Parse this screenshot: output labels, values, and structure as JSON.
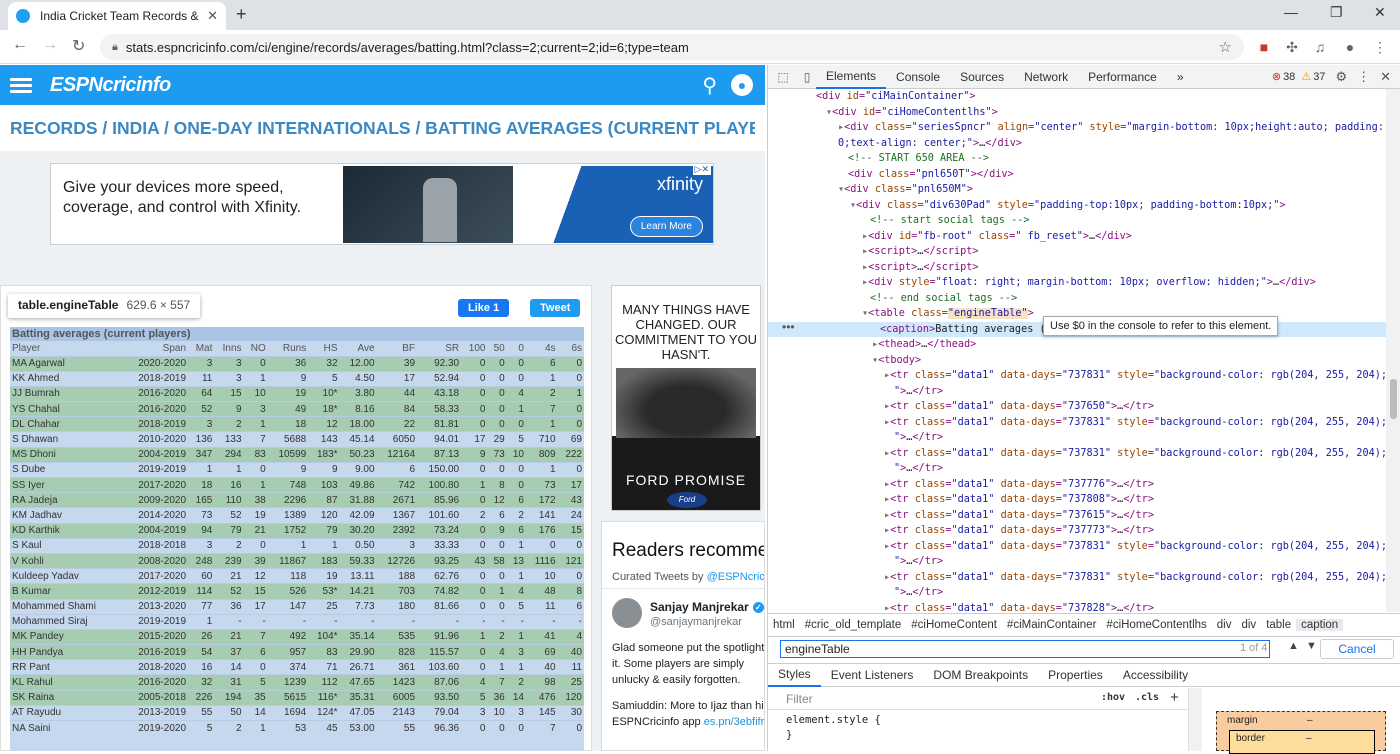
{
  "browser": {
    "tab_title": "India Cricket Team Records & Sta",
    "url": "stats.espncricinfo.com/ci/engine/records/averages/batting.html?class=2;current=2;id=6;type=team"
  },
  "site": {
    "logo": "ESPNcricinfo",
    "page_title": "RECORDS / INDIA / ONE-DAY INTERNATIONALS / BATTING AVERAGES (CURRENT PLAYERS)"
  },
  "ad1": {
    "text": "Give your devices more speed, coverage, and control with Xfinity.",
    "brand": "xfinity",
    "cta": "Learn More"
  },
  "ad2": {
    "text": "MANY THINGS HAVE CHANGED. OUR COMMITMENT TO YOU HASN'T.",
    "tagline": "FORD PROMISE",
    "brand": "Ford"
  },
  "inspector_tip": {
    "selector": "table.engineTable",
    "size": "629.6 × 557"
  },
  "social": {
    "like": "Like 1",
    "tweet": "Tweet"
  },
  "table": {
    "caption": "Batting averages (current players)",
    "headers": [
      "Player",
      "Span",
      "Mat",
      "Inns",
      "NO",
      "Runs",
      "HS",
      "Ave",
      "BF",
      "SR",
      "100",
      "50",
      "0",
      "4s",
      "6s"
    ],
    "rows": [
      [
        "MA Agarwal",
        "2020-2020",
        "3",
        "3",
        "0",
        "36",
        "32",
        "12.00",
        "39",
        "92.30",
        "0",
        "0",
        "0",
        "6",
        "0"
      ],
      [
        "KK Ahmed",
        "2018-2019",
        "11",
        "3",
        "1",
        "9",
        "5",
        "4.50",
        "17",
        "52.94",
        "0",
        "0",
        "0",
        "1",
        "0"
      ],
      [
        "JJ Bumrah",
        "2016-2020",
        "64",
        "15",
        "10",
        "19",
        "10*",
        "3.80",
        "44",
        "43.18",
        "0",
        "0",
        "4",
        "2",
        "1"
      ],
      [
        "YS Chahal",
        "2016-2020",
        "52",
        "9",
        "3",
        "49",
        "18*",
        "8.16",
        "84",
        "58.33",
        "0",
        "0",
        "1",
        "7",
        "0"
      ],
      [
        "DL Chahar",
        "2018-2019",
        "3",
        "2",
        "1",
        "18",
        "12",
        "18.00",
        "22",
        "81.81",
        "0",
        "0",
        "0",
        "1",
        "0"
      ],
      [
        "S Dhawan",
        "2010-2020",
        "136",
        "133",
        "7",
        "5688",
        "143",
        "45.14",
        "6050",
        "94.01",
        "17",
        "29",
        "5",
        "710",
        "69"
      ],
      [
        "MS Dhoni",
        "2004-2019",
        "347",
        "294",
        "83",
        "10599",
        "183*",
        "50.23",
        "12164",
        "87.13",
        "9",
        "73",
        "10",
        "809",
        "222"
      ],
      [
        "S Dube",
        "2019-2019",
        "1",
        "1",
        "0",
        "9",
        "9",
        "9.00",
        "6",
        "150.00",
        "0",
        "0",
        "0",
        "1",
        "0"
      ],
      [
        "SS Iyer",
        "2017-2020",
        "18",
        "16",
        "1",
        "748",
        "103",
        "49.86",
        "742",
        "100.80",
        "1",
        "8",
        "0",
        "73",
        "17"
      ],
      [
        "RA Jadeja",
        "2009-2020",
        "165",
        "110",
        "38",
        "2296",
        "87",
        "31.88",
        "2671",
        "85.96",
        "0",
        "12",
        "6",
        "172",
        "43"
      ],
      [
        "KM Jadhav",
        "2014-2020",
        "73",
        "52",
        "19",
        "1389",
        "120",
        "42.09",
        "1367",
        "101.60",
        "2",
        "6",
        "2",
        "141",
        "24"
      ],
      [
        "KD Karthik",
        "2004-2019",
        "94",
        "79",
        "21",
        "1752",
        "79",
        "30.20",
        "2392",
        "73.24",
        "0",
        "9",
        "6",
        "176",
        "15"
      ],
      [
        "S Kaul",
        "2018-2018",
        "3",
        "2",
        "0",
        "1",
        "1",
        "0.50",
        "3",
        "33.33",
        "0",
        "0",
        "1",
        "0",
        "0"
      ],
      [
        "V Kohli",
        "2008-2020",
        "248",
        "239",
        "39",
        "11867",
        "183",
        "59.33",
        "12726",
        "93.25",
        "43",
        "58",
        "13",
        "1116",
        "121"
      ],
      [
        "Kuldeep Yadav",
        "2017-2020",
        "60",
        "21",
        "12",
        "118",
        "19",
        "13.11",
        "188",
        "62.76",
        "0",
        "0",
        "1",
        "10",
        "0"
      ],
      [
        "B Kumar",
        "2012-2019",
        "114",
        "52",
        "15",
        "526",
        "53*",
        "14.21",
        "703",
        "74.82",
        "0",
        "1",
        "4",
        "48",
        "8"
      ],
      [
        "Mohammed Shami",
        "2013-2020",
        "77",
        "36",
        "17",
        "147",
        "25",
        "7.73",
        "180",
        "81.66",
        "0",
        "0",
        "5",
        "11",
        "6"
      ],
      [
        "Mohammed Siraj",
        "2019-2019",
        "1",
        "-",
        "-",
        "-",
        "-",
        "-",
        "-",
        "-",
        "-",
        "-",
        "-",
        "-",
        "-"
      ],
      [
        "MK Pandey",
        "2015-2020",
        "26",
        "21",
        "7",
        "492",
        "104*",
        "35.14",
        "535",
        "91.96",
        "1",
        "2",
        "1",
        "41",
        "4"
      ],
      [
        "HH Pandya",
        "2016-2019",
        "54",
        "37",
        "6",
        "957",
        "83",
        "29.90",
        "828",
        "115.57",
        "0",
        "4",
        "3",
        "69",
        "40"
      ],
      [
        "RR Pant",
        "2018-2020",
        "16",
        "14",
        "0",
        "374",
        "71",
        "26.71",
        "361",
        "103.60",
        "0",
        "1",
        "1",
        "40",
        "11"
      ],
      [
        "KL Rahul",
        "2016-2020",
        "32",
        "31",
        "5",
        "1239",
        "112",
        "47.65",
        "1423",
        "87.06",
        "4",
        "7",
        "2",
        "98",
        "25"
      ],
      [
        "SK Raina",
        "2005-2018",
        "226",
        "194",
        "35",
        "5615",
        "116*",
        "35.31",
        "6005",
        "93.50",
        "5",
        "36",
        "14",
        "476",
        "120"
      ],
      [
        "AT Rayudu",
        "2013-2019",
        "55",
        "50",
        "14",
        "1694",
        "124*",
        "47.05",
        "2143",
        "79.04",
        "3",
        "10",
        "3",
        "145",
        "30"
      ],
      [
        "NA Saini",
        "2019-2020",
        "5",
        "2",
        "1",
        "53",
        "45",
        "53.00",
        "55",
        "96.36",
        "0",
        "0",
        "0",
        "7",
        "0"
      ]
    ],
    "highlight_rows": [
      0,
      2,
      3,
      4,
      6,
      8,
      9,
      11,
      13,
      15,
      18,
      19,
      21,
      22
    ]
  },
  "twitter": {
    "heading": "Readers recommend",
    "curated_prefix": "Curated Tweets by ",
    "curated_handle": "@ESPNcricinfo",
    "author": "Sanjay Manjrekar",
    "handle": "@sanjaymanjrekar",
    "tweet": "Glad someone put the spotlight on it. Some players are simply unlucky & easily forgotten.",
    "tweet2_prefix": "Samiuddin: More to Ijaz than his ESPNCricinfo app ",
    "tweet2_link": "es.pn/3ebfifr"
  },
  "devtools": {
    "tabs": [
      "Elements",
      "Console",
      "Sources",
      "Network",
      "Performance",
      "»"
    ],
    "errors": "38",
    "warnings": "37",
    "hover_tip": "Use $0 in the console to refer to this element.",
    "breadcrumbs": [
      "html",
      "#cric_old_template",
      "#ciHomeContent",
      "#ciMainContainer",
      "#ciHomeContentlhs",
      "div",
      "div",
      "table",
      "caption"
    ],
    "find_value": "engineTable",
    "find_count": "1 of 4",
    "cancel": "Cancel",
    "style_tabs": [
      "Styles",
      "Event Listeners",
      "DOM Breakpoints",
      "Properties",
      "Accessibility"
    ],
    "filter_placeholder": "Filter",
    "hov": ":hov",
    "cls": ".cls",
    "element_style": "element.style {",
    "element_style_close": "}",
    "box_margin": "margin",
    "box_border": "border",
    "box_dash": "–"
  }
}
